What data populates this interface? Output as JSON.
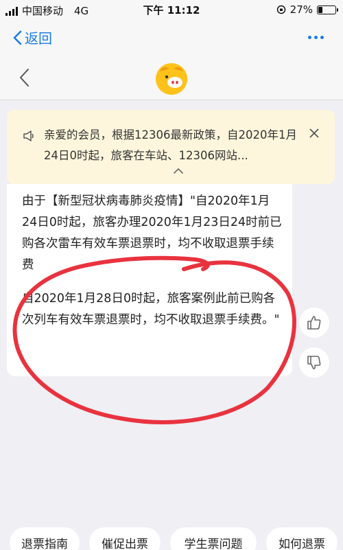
{
  "status_bar": {
    "carrier": "中国移动",
    "network": "4G",
    "time": "下午 11:12",
    "battery_text": "27%",
    "battery_level": 0.27
  },
  "nav": {
    "back_label": "返回"
  },
  "notice": {
    "text": "亲爱的会员，根据12306最新政策，自2020年1月24日0时起，旅客在车站、12306网站..."
  },
  "message": {
    "paragraph_1": "由于【新型冠状病毒肺炎疫情】\"自2020年1月24日0时起，旅客办理2020年1月23日24时前已购各次雷车有效车票退票时，均不收取退票手续费",
    "paragraph_2": "自2020年1月28日0时起，旅客案例此前已购各次列车有效车票退票时，均不收取退票手续费。\""
  },
  "quick_replies": [
    {
      "label": "退票指南"
    },
    {
      "label": "催促出票"
    },
    {
      "label": "学生票问题"
    },
    {
      "label": "如何退票"
    }
  ],
  "colors": {
    "accent": "#1a7ce8",
    "notice_bg": "#fdf6dc",
    "annotation": "#e8333f",
    "logo": "#ffc21a"
  }
}
